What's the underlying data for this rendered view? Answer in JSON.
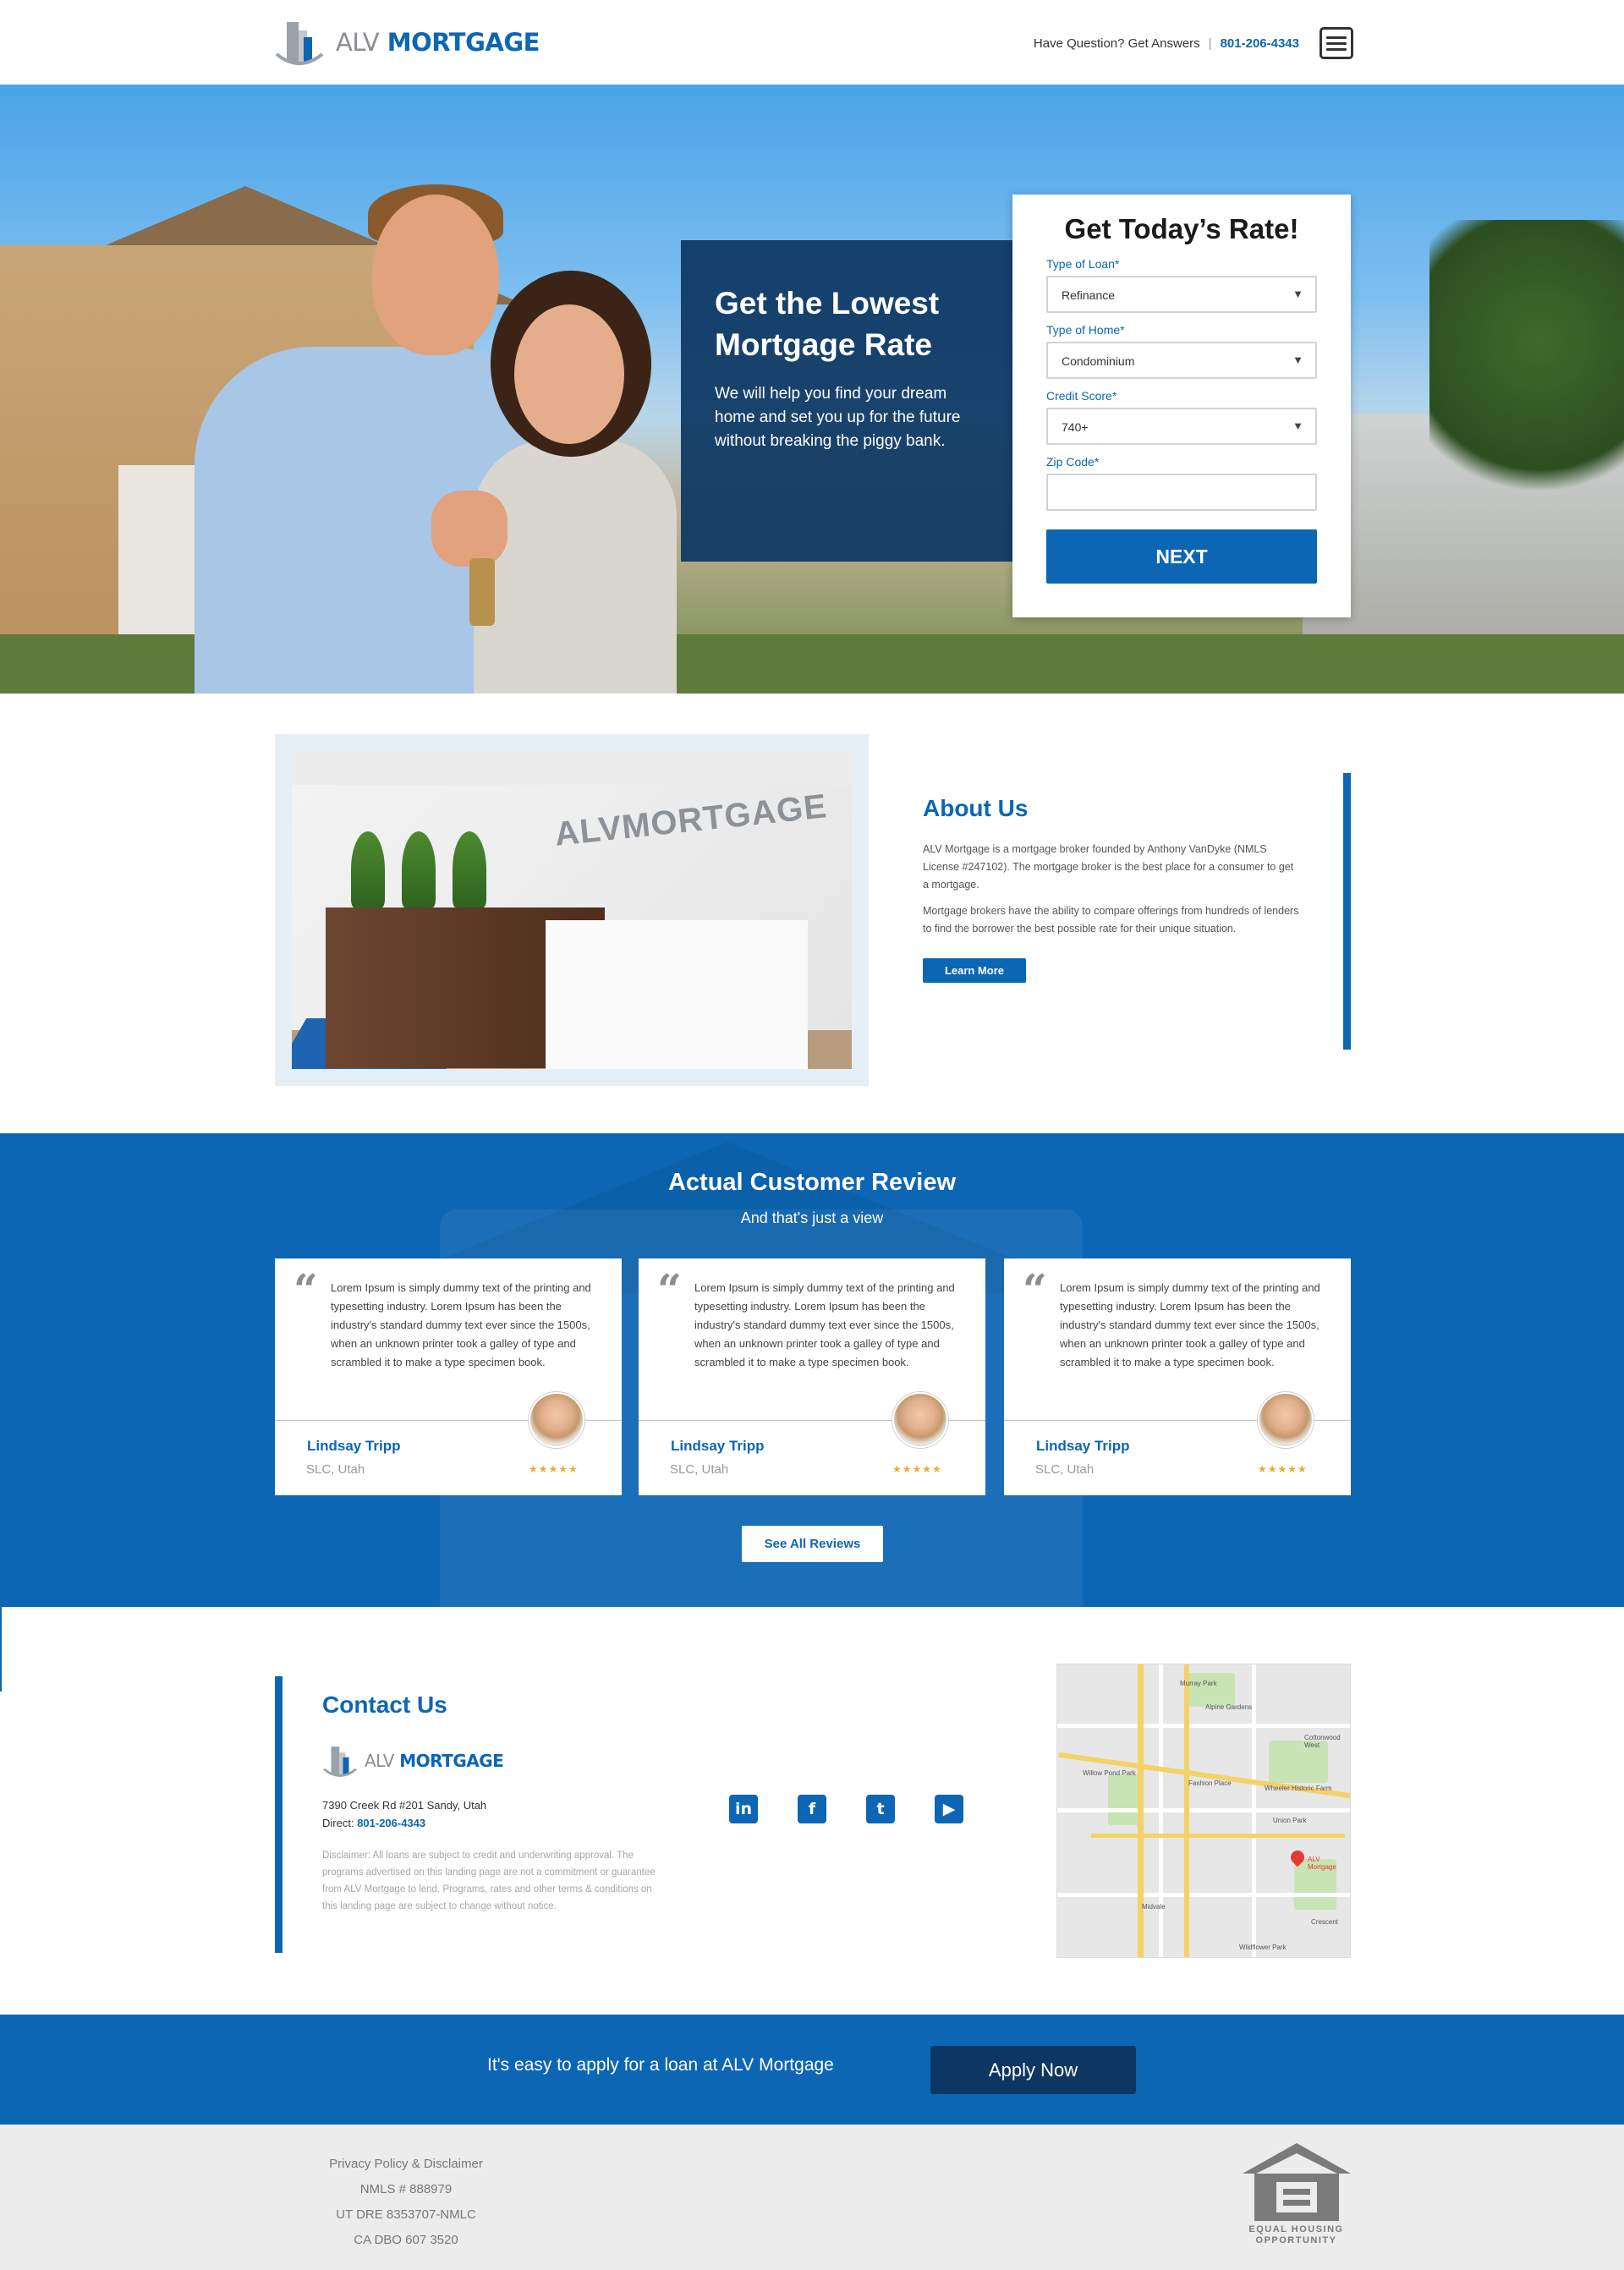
{
  "header": {
    "brand_part1": "ALV",
    "brand_part2": "MORTGAGE",
    "question": "Have Question? Get Answers",
    "separator": "|",
    "phone": "801-206-4343"
  },
  "hero": {
    "headline": "Get the Lowest Mortgage Rate",
    "body": "We will help you find your dream home and set you up for the future without breaking the piggy bank."
  },
  "rate_form": {
    "title": "Get Today’s Rate!",
    "loan_label": "Type of Loan",
    "loan_value": "Refinance",
    "home_label": "Type of Home",
    "home_value": "Condominium",
    "credit_label": "Credit Score",
    "credit_value": "740+",
    "zip_label": "Zip Code",
    "zip_value": "",
    "required_mark": "*",
    "submit_label": "NEXT"
  },
  "about": {
    "sign_text": "ALVMORTGAGE",
    "title": "About Us",
    "para1": "ALV Mortgage is a mortgage broker founded by Anthony VanDyke (NMLS License #247102). The mortgage broker is the best place for a consumer to get a mortgage.",
    "para2": "Mortgage brokers have the ability to compare offerings from hundreds of lenders to find the borrower the best possible rate for their unique situation.",
    "button": "Learn More"
  },
  "reviews": {
    "title": "Actual Customer Review",
    "subtitle": "And that's just a view",
    "quote_mark": "“",
    "items": [
      {
        "text": "Lorem Ipsum is simply dummy text of the printing and typesetting industry. Lorem Ipsum has been the industry's standard dummy text ever since the 1500s, when an unknown printer took a galley of type and scrambled it to make a type specimen book.",
        "name": "Lindsay Tripp",
        "location": "SLC, Utah",
        "stars": "★★★★★"
      },
      {
        "text": "Lorem Ipsum is simply dummy text of the printing and typesetting industry. Lorem Ipsum has been the industry's standard dummy text ever since the 1500s, when an unknown printer took a galley of type and scrambled it to make a type specimen book.",
        "name": "Lindsay Tripp",
        "location": "SLC, Utah",
        "stars": "★★★★★"
      },
      {
        "text": "Lorem Ipsum is simply dummy text of the printing and typesetting industry. Lorem Ipsum has been the industry's standard dummy text ever since the 1500s, when an unknown printer took a galley of type and scrambled it to make a type specimen book.",
        "name": "Lindsay Tripp",
        "location": "SLC, Utah",
        "stars": "★★★★★"
      }
    ],
    "button": "See All Reviews"
  },
  "contact": {
    "title": "Contact Us",
    "address": "7390 Creek Rd #201 Sandy, Utah",
    "direct_label": "Direct:",
    "direct_phone": "801-206-4343",
    "disclaimer": "Disclaimer: All loans are subject to credit and underwriting approval. The programs advertised on this landing page are not a commitment or guarantee from ALV Mortgage to lend. Programs, rates and other terms & conditions on this landing page are subject to change without notice.",
    "socials": [
      {
        "icon": "linkedin-icon",
        "glyph": "in"
      },
      {
        "icon": "facebook-icon",
        "glyph": "f"
      },
      {
        "icon": "twitter-icon",
        "glyph": "t"
      },
      {
        "icon": "youtube-icon",
        "glyph": "▶"
      }
    ]
  },
  "map": {
    "labels": [
      "Murray Park",
      "Alpine Gardens",
      "Cottonwood West",
      "Willow Pond Park",
      "Fashion Place",
      "Wheeler Historic Farm",
      "Midvale",
      "Union Park",
      "Crescent",
      "Wildflower Park"
    ],
    "pin_label": "ALV Mortgage"
  },
  "apply": {
    "text": "It's easy to apply for a loan at ALV Mortgage",
    "button": "Apply Now"
  },
  "footer": {
    "line1": "Privacy Policy & Disclaimer",
    "line2": "NMLS # 888979",
    "line3": "UT DRE 8353707-NMLC",
    "line4": "CA DBO 607 3520",
    "eho_line1": "EQUAL HOUSING",
    "eho_line2": "OPPORTUNITY"
  },
  "colors": {
    "brand_blue": "#0c66b4",
    "navy": "#0d3762",
    "grey": "#8a8d92",
    "star": "#f0a830"
  }
}
